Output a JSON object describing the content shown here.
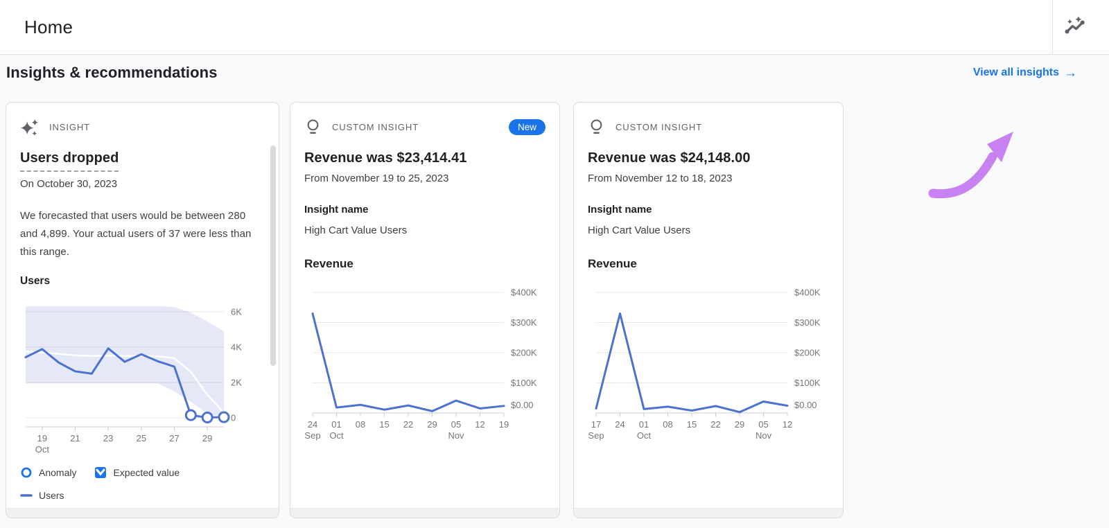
{
  "header": {
    "title": "Home",
    "insights_button_icon": "insights-sparkline-icon"
  },
  "section": {
    "title": "Insights & recommendations",
    "view_all_label": "View all insights",
    "view_all_arrow": "→",
    "link_color": "#1a73e8"
  },
  "annotation": {
    "name": "purple-curved-arrow",
    "color": "#c781f1"
  },
  "cards": [
    {
      "type_label": "INSIGHT",
      "icon": "sparkle-stars-icon",
      "title": "Users dropped",
      "subtitle": "On October 30, 2023",
      "body": "We forecasted that users would be between 280 and 4,899. Your actual users of 37 were less than this range.",
      "legend": [
        {
          "icon": "anomaly-circle-icon",
          "label": "Anomaly"
        },
        {
          "icon": "expected-value-icon",
          "label": "Expected value"
        },
        {
          "icon": "users-line-icon",
          "label": "Users"
        }
      ],
      "chart_data": {
        "type": "line",
        "variant": "forecast",
        "title": "Users",
        "x_dates": [
          "Oct 18",
          "Oct 19",
          "Oct 20",
          "Oct 21",
          "Oct 22",
          "Oct 23",
          "Oct 24",
          "Oct 25",
          "Oct 26",
          "Oct 27",
          "Oct 28",
          "Oct 29",
          "Oct 30"
        ],
        "series": [
          {
            "name": "Users",
            "values": [
              3430,
              3890,
              3130,
              2630,
              2500,
              3930,
              3170,
              3600,
              3200,
              2900,
              150,
              20,
              37
            ]
          },
          {
            "name": "Expected value",
            "values": [
              3750,
              3700,
              3620,
              3540,
              3500,
              3520,
              3500,
              3520,
              3480,
              3380,
              2600,
              1300,
              300
            ]
          }
        ],
        "band": {
          "upper": [
            6320,
            6320,
            6320,
            6320,
            6320,
            6320,
            6320,
            6320,
            6320,
            6280,
            5950,
            5450,
            4900
          ],
          "lower": [
            1950,
            1950,
            1950,
            1950,
            1950,
            1950,
            1950,
            1950,
            1950,
            1500,
            900,
            250,
            50
          ]
        },
        "anomaly_indices": [
          10,
          11,
          12
        ],
        "y_ticks": [
          {
            "value": 6000,
            "label": "6K"
          },
          {
            "value": 4000,
            "label": "4K"
          },
          {
            "value": 2000,
            "label": "2K"
          },
          {
            "value": 0,
            "label": "0"
          }
        ],
        "x_tick_labels": [
          {
            "index": 1,
            "label": "19",
            "sub": "Oct"
          },
          {
            "index": 3,
            "label": "21"
          },
          {
            "index": 5,
            "label": "23"
          },
          {
            "index": 7,
            "label": "25"
          },
          {
            "index": 9,
            "label": "27"
          },
          {
            "index": 11,
            "label": "29"
          }
        ],
        "ylim": [
          0,
          6500
        ],
        "grid": true,
        "legend_position": "bottom",
        "line_color": "#4c72d0",
        "band_color": "#e4e8f7",
        "expected_color": "#ffffff"
      }
    },
    {
      "type_label": "CUSTOM INSIGHT",
      "icon": "lightbulb-icon",
      "badge": "New",
      "title": "Revenue was $23,414.41",
      "subtitle": "From November 19 to 25, 2023",
      "insight_name_label": "Insight name",
      "insight_name": "High Cart Value Users",
      "chart_data": {
        "type": "line",
        "variant": "weekly",
        "title": "Revenue",
        "x_dates": [
          "Sep 24",
          "Oct 01",
          "Oct 08",
          "Oct 15",
          "Oct 22",
          "Oct 29",
          "Nov 05",
          "Nov 12",
          "Nov 19"
        ],
        "series": [
          {
            "name": "Revenue",
            "values": [
              330000,
              18000,
              27000,
              11000,
              25000,
              6000,
              41000,
              15000,
              23414
            ]
          }
        ],
        "y_ticks": [
          {
            "value": 400000,
            "label": "$400K"
          },
          {
            "value": 300000,
            "label": "$300K"
          },
          {
            "value": 200000,
            "label": "$200K"
          },
          {
            "value": 100000,
            "label": "$100K"
          },
          {
            "value": 0,
            "label": "$0.00"
          }
        ],
        "x_tick_labels": [
          {
            "index": 0,
            "label": "24",
            "sub": "Sep"
          },
          {
            "index": 1,
            "label": "01",
            "sub": "Oct"
          },
          {
            "index": 2,
            "label": "08"
          },
          {
            "index": 3,
            "label": "15"
          },
          {
            "index": 4,
            "label": "22"
          },
          {
            "index": 5,
            "label": "29"
          },
          {
            "index": 6,
            "label": "05",
            "sub": "Nov"
          },
          {
            "index": 7,
            "label": "12"
          },
          {
            "index": 8,
            "label": "19"
          }
        ],
        "ylim": [
          0,
          400000
        ],
        "grid": true,
        "line_color": "#4c72d0"
      }
    },
    {
      "type_label": "CUSTOM INSIGHT",
      "icon": "lightbulb-icon",
      "title": "Revenue was $24,148.00",
      "subtitle": "From November 12 to 18, 2023",
      "insight_name_label": "Insight name",
      "insight_name": "High Cart Value Users",
      "chart_data": {
        "type": "line",
        "variant": "weekly",
        "title": "Revenue",
        "x_dates": [
          "Sep 17",
          "Sep 24",
          "Oct 01",
          "Oct 08",
          "Oct 15",
          "Oct 22",
          "Oct 29",
          "Nov 05",
          "Nov 12"
        ],
        "series": [
          {
            "name": "Revenue",
            "values": [
              15000,
              330000,
              13000,
              21000,
              8000,
              23000,
              3000,
              38000,
              24148
            ]
          }
        ],
        "y_ticks": [
          {
            "value": 400000,
            "label": "$400K"
          },
          {
            "value": 300000,
            "label": "$300K"
          },
          {
            "value": 200000,
            "label": "$200K"
          },
          {
            "value": 100000,
            "label": "$100K"
          },
          {
            "value": 0,
            "label": "$0.00"
          }
        ],
        "x_tick_labels": [
          {
            "index": 0,
            "label": "17",
            "sub": "Sep"
          },
          {
            "index": 1,
            "label": "24"
          },
          {
            "index": 2,
            "label": "01",
            "sub": "Oct"
          },
          {
            "index": 3,
            "label": "08"
          },
          {
            "index": 4,
            "label": "15"
          },
          {
            "index": 5,
            "label": "22"
          },
          {
            "index": 6,
            "label": "29"
          },
          {
            "index": 7,
            "label": "05",
            "sub": "Nov"
          },
          {
            "index": 8,
            "label": "12"
          }
        ],
        "ylim": [
          0,
          400000
        ],
        "grid": true,
        "line_color": "#4c72d0"
      }
    }
  ]
}
